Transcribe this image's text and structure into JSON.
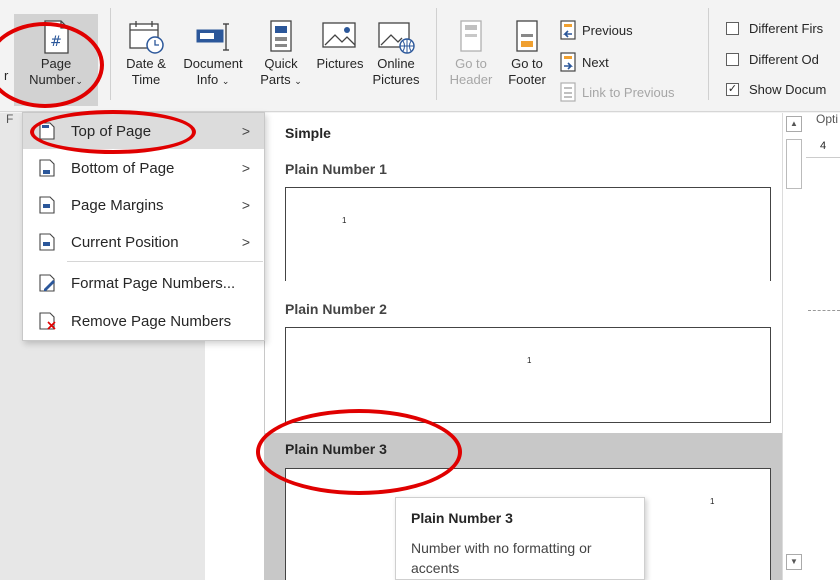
{
  "ribbon": {
    "left_cut_label": "r",
    "page_number": {
      "line1": "Page",
      "line2": "Number",
      "chevron": "⌄"
    },
    "date_time": {
      "line1": "Date &",
      "line2": "Time"
    },
    "document_info": {
      "line1": "Document",
      "line2": "Info",
      "chevron": "⌄"
    },
    "quick_parts": {
      "line1": "Quick",
      "line2": "Parts",
      "chevron": "⌄"
    },
    "pictures": {
      "line1": "Pictures",
      "line2": ""
    },
    "online_pictures": {
      "line1": "Online",
      "line2": "Pictures"
    },
    "go_to_header": {
      "line1": "Go to",
      "line2": "Header"
    },
    "go_to_footer": {
      "line1": "Go to",
      "line2": "Footer"
    },
    "previous": "Previous",
    "next": "Next",
    "link_to_previous": "Link to Previous",
    "options": [
      {
        "label": "Different Firs",
        "checked": false
      },
      {
        "label": "Different Od",
        "checked": false
      },
      {
        "label": "Show Docum",
        "checked": true
      }
    ],
    "group_strip_left": "F",
    "group_strip_right": "Opti"
  },
  "ruler": {
    "tick": "4"
  },
  "menu": {
    "items": [
      {
        "label": "Top of Page",
        "has_submenu": true,
        "active": true
      },
      {
        "label": "Bottom of Page",
        "has_submenu": true
      },
      {
        "label": "Page Margins",
        "has_submenu": true
      },
      {
        "label": "Current Position",
        "has_submenu": true
      },
      {
        "label": "Format Page Numbers...",
        "has_submenu": false
      },
      {
        "label": "Remove Page Numbers",
        "has_submenu": false
      }
    ],
    "arrow": ">"
  },
  "gallery": {
    "section": "Simple",
    "items": [
      {
        "label": "Plain Number 1",
        "number": "1"
      },
      {
        "label": "Plain Number 2",
        "number": "1"
      },
      {
        "label": "Plain Number 3",
        "number": "1"
      }
    ]
  },
  "tooltip": {
    "title": "Plain Number 3",
    "description": "Number with no formatting or accents"
  },
  "colors": {
    "annotation": "#e00000",
    "highlight": "#c8c8c8",
    "accent": "#2b579a"
  }
}
